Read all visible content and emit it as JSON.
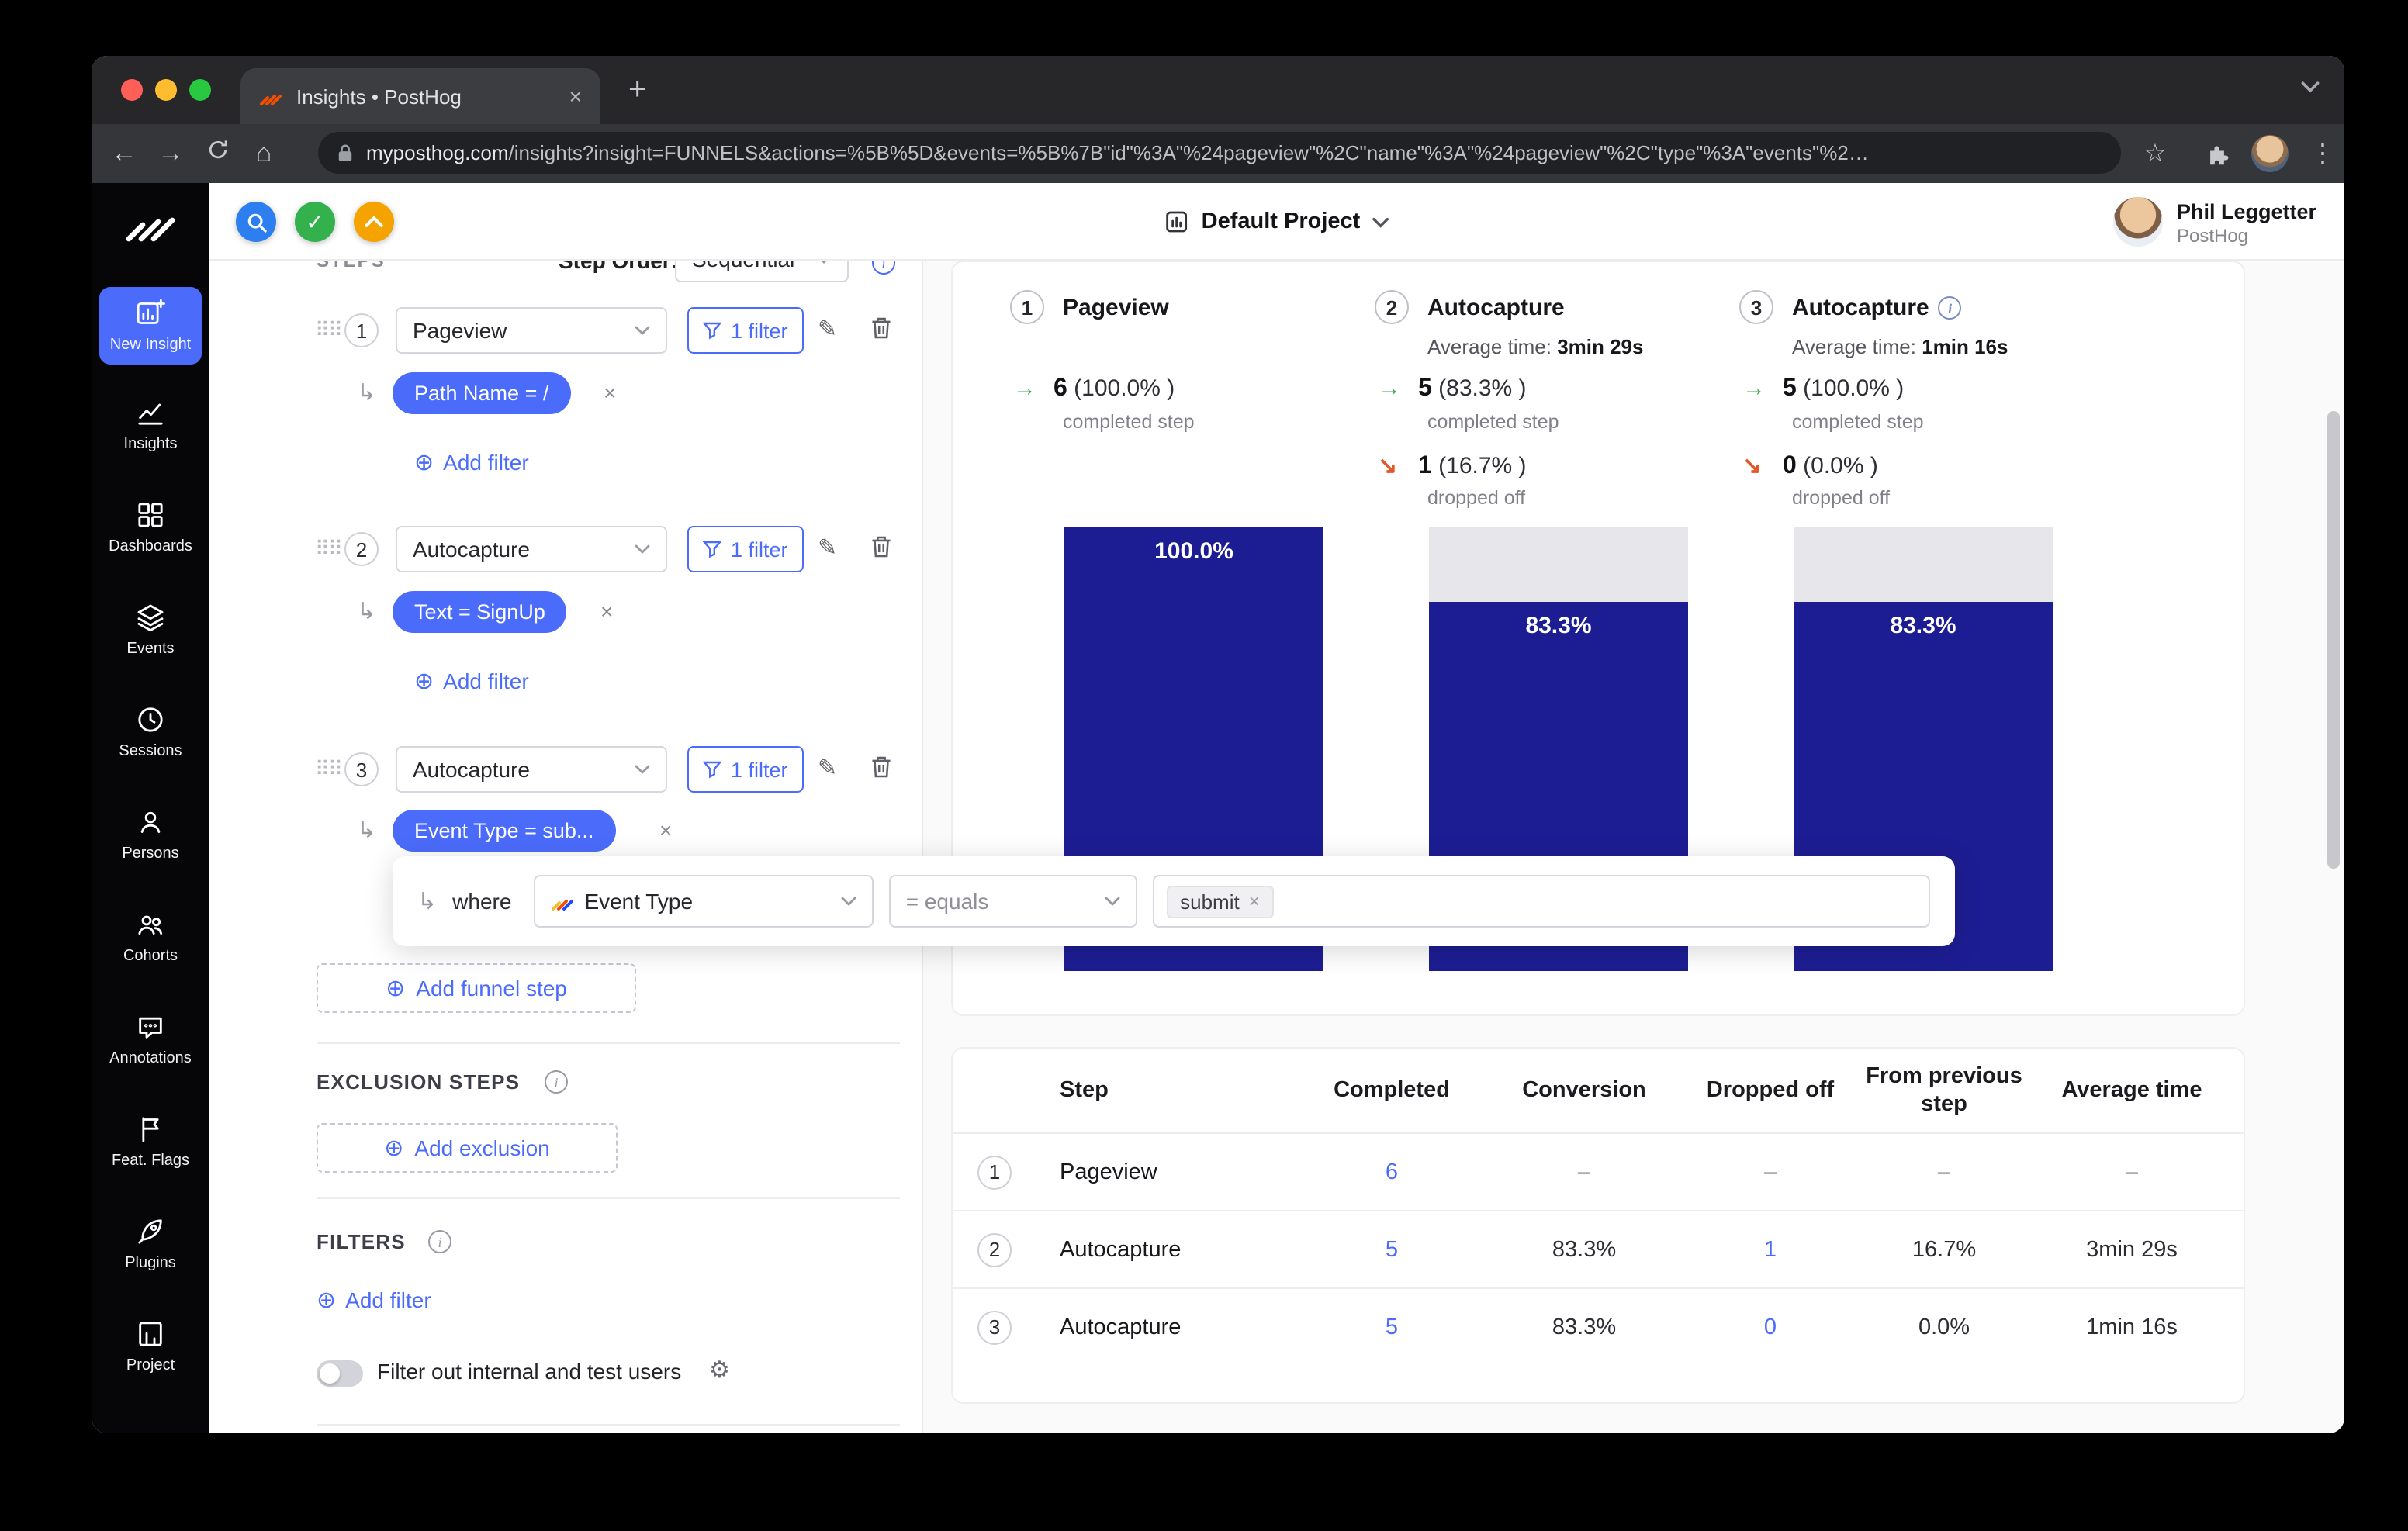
{
  "colors": {
    "accent": "#4b6bfb",
    "link": "#4b6bfb",
    "bar-fill": "#1d1d93",
    "bar-track": "#e7e7eb",
    "success": "#3fa94f",
    "dropped": "#e3572b"
  },
  "icons": {
    "back": "←",
    "forward": "→",
    "home": "⌂",
    "star": "☆",
    "kebab": "⋮",
    "tab_close": "×",
    "new_tab": "+",
    "drag_handle": "⠿⠿",
    "sub_arrow": "↳",
    "add": "⊕",
    "pencil": "✎",
    "gear": "⚙",
    "check": "✓",
    "completed_arrow": "→",
    "dropped_arrow": "↘",
    "remove": "×",
    "info": "i"
  },
  "browser": {
    "tab": {
      "title": "Insights • PostHog"
    },
    "url_domain": "myposthog.com",
    "url_path": "/insights?insight=FUNNELS&actions=%5B%5D&events=%5B%7B\"id\"%3A\"%24pageview\"%2C\"name\"%3A\"%24pageview\"%2C\"type\"%3A\"events\"%2…"
  },
  "app_header": {
    "project": "Default Project",
    "user": {
      "name": "Phil Leggetter",
      "org": "PostHog"
    }
  },
  "sidebar": {
    "items": [
      {
        "label": "New Insight"
      },
      {
        "label": "Insights"
      },
      {
        "label": "Dashboards"
      },
      {
        "label": "Events"
      },
      {
        "label": "Sessions"
      },
      {
        "label": "Persons"
      },
      {
        "label": "Cohorts"
      },
      {
        "label": "Annotations"
      },
      {
        "label": "Feat. Flags"
      },
      {
        "label": "Plugins"
      },
      {
        "label": "Project"
      }
    ]
  },
  "steps_panel": {
    "section_label": "STEPS",
    "order_label": "Step Order:",
    "order_value": "Sequential",
    "add_filter_label": "Add filter",
    "steps": [
      {
        "num": "1",
        "event": "Pageview",
        "filter_count": "1 filter",
        "pill": "Path Name = /"
      },
      {
        "num": "2",
        "event": "Autocapture",
        "filter_count": "1 filter",
        "pill": "Text = SignUp"
      },
      {
        "num": "3",
        "event": "Autocapture",
        "filter_count": "1 filter",
        "pill": "Event Type = sub..."
      }
    ],
    "where_popup": {
      "where_label": "where",
      "property": "Event Type",
      "operator": "= equals",
      "tag": "submit"
    },
    "add_funnel_step": "Add funnel step",
    "exclusion_heading": "EXCLUSION STEPS",
    "add_exclusion": "Add exclusion",
    "filters_heading": "FILTERS",
    "toggle_label": "Filter out internal and test users"
  },
  "funnel": {
    "columns": [
      {
        "num": "1",
        "title": "Pageview",
        "avg_label": "",
        "avg_value": "",
        "completed_value": "6",
        "completed_pct": "(100.0% )",
        "completed_label": "completed step",
        "dropped_value": "",
        "dropped_pct": "",
        "dropped_label": "",
        "bar_label": "100.0%",
        "fill_pct": 100
      },
      {
        "num": "2",
        "title": "Autocapture",
        "avg_label": "Average time:",
        "avg_value": "3min 29s",
        "completed_value": "5",
        "completed_pct": "(83.3% )",
        "completed_label": "completed step",
        "dropped_value": "1",
        "dropped_pct": "(16.7% )",
        "dropped_label": "dropped off",
        "bar_label": "83.3%",
        "fill_pct": 83.3
      },
      {
        "num": "3",
        "title": "Autocapture",
        "avg_label": "Average time:",
        "avg_value": "1min 16s",
        "completed_value": "5",
        "completed_pct": "(100.0% )",
        "completed_label": "completed step",
        "dropped_value": "0",
        "dropped_pct": "(0.0% )",
        "dropped_label": "dropped off",
        "bar_label": "83.3%",
        "fill_pct": 83.3
      }
    ]
  },
  "table": {
    "headers": [
      "Step",
      "Completed",
      "Conversion",
      "Dropped off",
      "From previous step",
      "Average time"
    ],
    "rows": [
      {
        "num": "1",
        "step": "Pageview",
        "completed": "6",
        "conversion": "–",
        "dropped": "–",
        "from_previous": "–",
        "avg_time": "–"
      },
      {
        "num": "2",
        "step": "Autocapture",
        "completed": "5",
        "conversion": "83.3%",
        "dropped": "1",
        "from_previous": "16.7%",
        "avg_time": "3min 29s"
      },
      {
        "num": "3",
        "step": "Autocapture",
        "completed": "5",
        "conversion": "83.3%",
        "dropped": "0",
        "from_previous": "0.0%",
        "avg_time": "1min 16s"
      }
    ]
  }
}
